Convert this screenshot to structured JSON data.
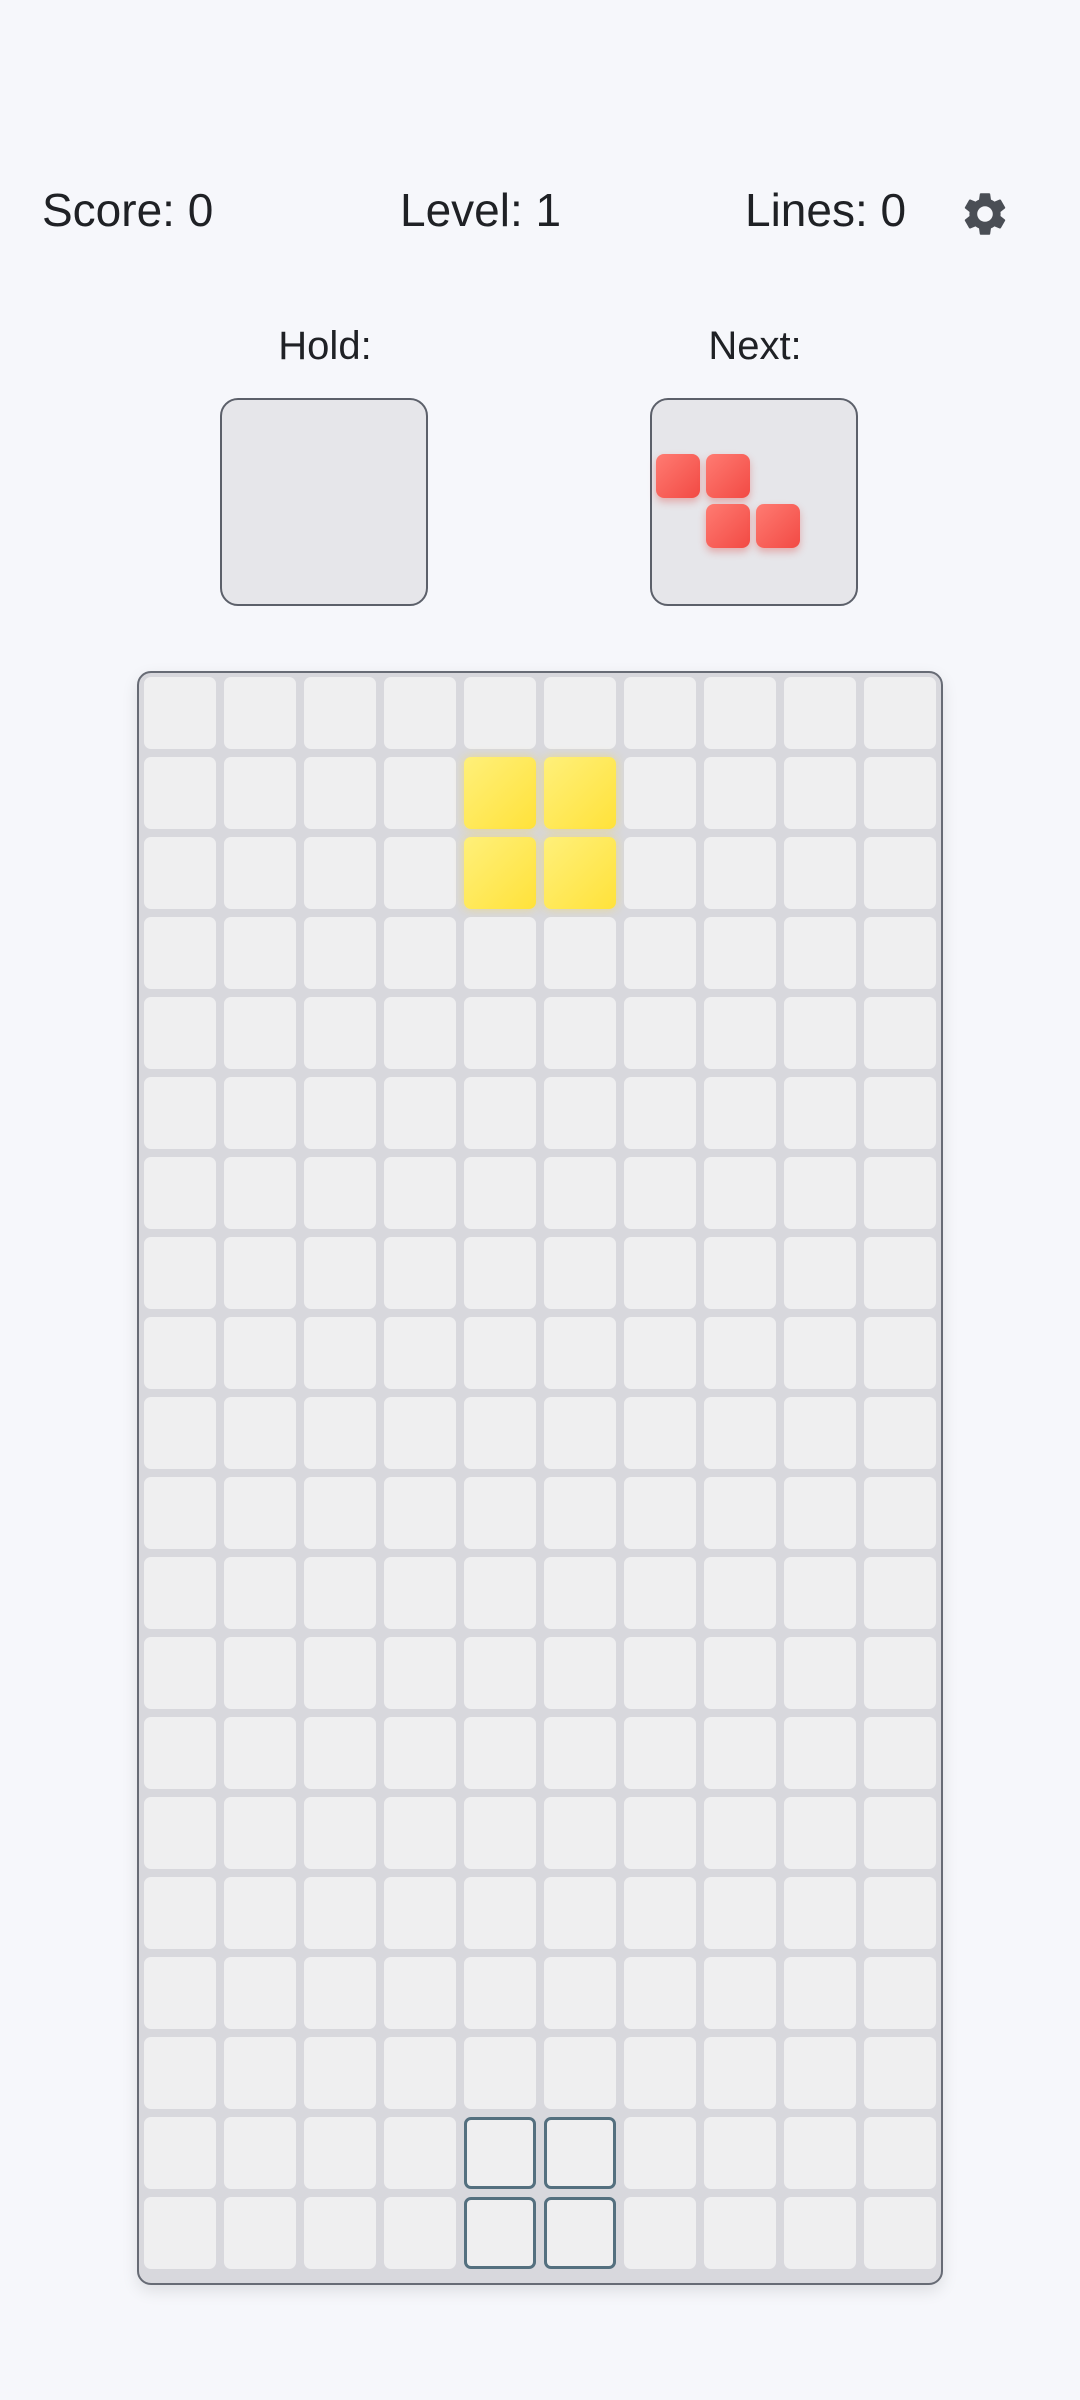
{
  "stats": {
    "score": "Score: 0",
    "level": "Level: 1",
    "lines": "Lines: 0"
  },
  "settings": {
    "icon": "gear-icon",
    "color": "#4a4e55"
  },
  "hold": {
    "label": "Hold:",
    "piece": null
  },
  "next": {
    "label": "Next:",
    "piece": "Z",
    "color": "#f24a44",
    "cells": [
      [
        0,
        0
      ],
      [
        0,
        1
      ],
      [
        1,
        1
      ],
      [
        1,
        2
      ]
    ]
  },
  "board": {
    "columns": 10,
    "rows": 20,
    "active_piece": {
      "type": "O",
      "color": "#ffe23a",
      "cells": [
        [
          1,
          4
        ],
        [
          1,
          5
        ],
        [
          2,
          4
        ],
        [
          2,
          5
        ]
      ]
    },
    "ghost_piece": {
      "color": "#54707f",
      "cells": [
        [
          18,
          4
        ],
        [
          18,
          5
        ],
        [
          19,
          4
        ],
        [
          19,
          5
        ]
      ]
    }
  }
}
